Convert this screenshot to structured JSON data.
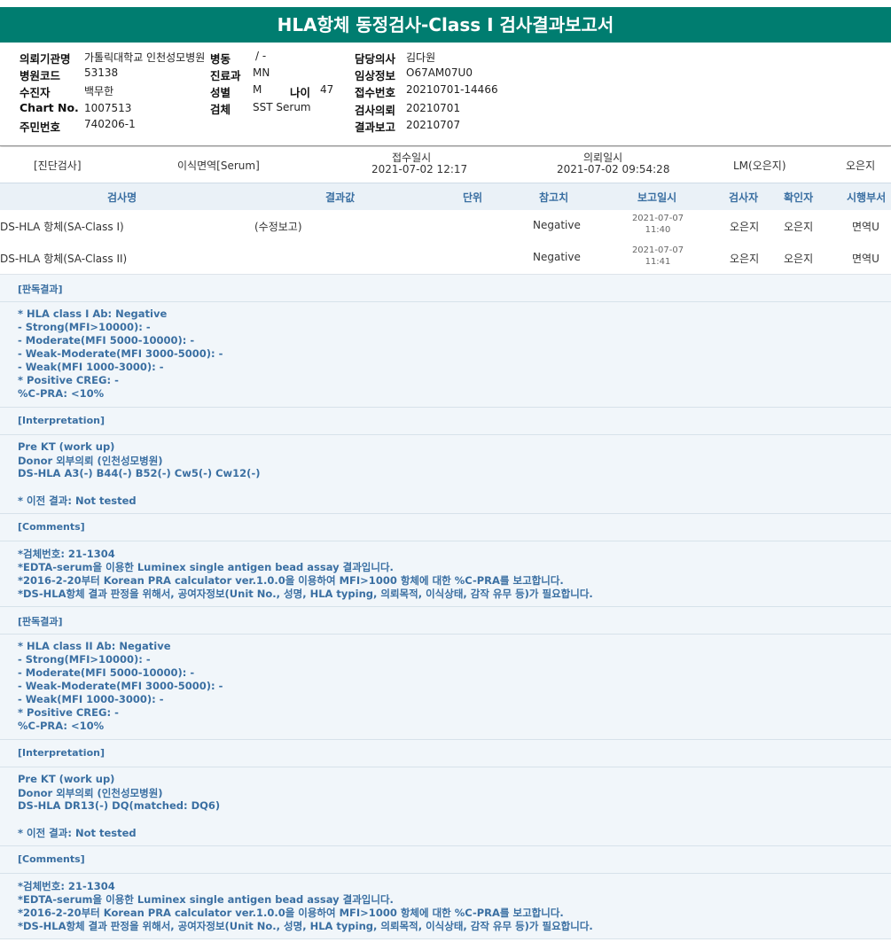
{
  "title": "HLA항체 동정검사-Class I 검사결과보고서",
  "patient": {
    "hospital_label": "의뢰기관명",
    "hospital": "가톨릭대학교 인천성모병원",
    "ward_label": "병동",
    "ward": "/ -",
    "doctor_label": "담당의사",
    "doctor": "김다원",
    "hospital_code_label": "병원코드",
    "hospital_code": "53138",
    "dept_label": "진료과",
    "dept": "MN",
    "clinical_label": "임상정보",
    "clinical": "O67AM07U0",
    "name_label": "수진자",
    "name": "백무한",
    "sex_label": "성별",
    "sex": "M",
    "age_label": "나이",
    "age": "47",
    "reception_no_label": "접수번호",
    "reception_no": "20210701-14466",
    "chart_label": "Chart No.",
    "chart": "1007513",
    "specimen_label": "검체",
    "specimen": "SST Serum",
    "request_date_label": "검사의뢰",
    "request_date": "20210701",
    "id_label": "주민번호",
    "id": "740206-1",
    "report_date_label": "결과보고",
    "report_date": "20210707"
  },
  "reception": {
    "diagnosis": "[진단검사]",
    "specimen_type": "이식면역[Serum]",
    "received_label": "접수일시",
    "received": "2021-07-02  12:17",
    "requested_label": "의뢰일시",
    "requested": "2021-07-02  09:54:28",
    "staff1": "LM(오은지)",
    "staff2": "오은지"
  },
  "table": {
    "headers": [
      "검사명",
      "결과값",
      "단위",
      "참고치",
      "보고일시",
      "검사자",
      "확인자",
      "시행부서"
    ],
    "rows": [
      {
        "name": "DS-HLA 항체(SA-Class I)",
        "result": "(수정보고)",
        "unit": "",
        "ref": "Negative",
        "date": "2021-07-07",
        "time": "11:40",
        "tester": "오은지",
        "checker": "오은지",
        "dept": "면역U"
      },
      {
        "name": "DS-HLA 항체(SA-Class II)",
        "result": "",
        "unit": "",
        "ref": "Negative",
        "date": "2021-07-07",
        "time": "11:41",
        "tester": "오은지",
        "checker": "오은지",
        "dept": "면역U"
      }
    ]
  },
  "sections": {
    "s1": {
      "title": "[판독결과]",
      "lines": [
        "* HLA class I Ab: Negative",
        "- Strong(MFI>10000): -",
        "- Moderate(MFI 5000-10000): -",
        "- Weak-Moderate(MFI 3000-5000): -",
        "- Weak(MFI 1000-3000): -",
        "* Positive CREG: -",
        " %C-PRA: <10%"
      ]
    },
    "s2": {
      "title": "[Interpretation]",
      "lines": [
        "Pre KT (work up)",
        "Donor 외부의뢰 (인천성모병원)",
        "DS-HLA A3(-) B44(-) B52(-) Cw5(-) Cw12(-)",
        "",
        "* 이전 결과: Not tested"
      ]
    },
    "s3": {
      "title": "[Comments]",
      "lines": [
        "*검체번호: 21-1304",
        "*EDTA-serum을 이용한 Luminex single antigen bead assay 결과입니다.",
        "*2016-2-20부터 Korean PRA calculator ver.1.0.0을 이용하여 MFI>1000 항체에 대한 %C-PRA를 보고합니다.",
        "*DS-HLA항체 결과 판정을 위해서, 공여자정보(Unit No., 성명, HLA typing, 의뢰목적, 이식상태, 감작 유무 등)가 필요합니다."
      ]
    },
    "s4": {
      "title": "[판독결과]",
      "lines": [
        "* HLA class II Ab: Negative",
        "- Strong(MFI>10000): -",
        "- Moderate(MFI 5000-10000): -",
        "- Weak-Moderate(MFI 3000-5000): -",
        "- Weak(MFI 1000-3000): -",
        "* Positive CREG: -",
        " %C-PRA: <10%"
      ]
    },
    "s5": {
      "title": "[Interpretation]",
      "lines": [
        "Pre KT (work up)",
        "Donor 외부의뢰 (인천성모병원)",
        "DS-HLA DR13(-) DQ(matched: DQ6)",
        "",
        "* 이전 결과: Not tested"
      ]
    },
    "s6": {
      "title": "[Comments]",
      "lines": [
        "*검체번호: 21-1304",
        "*EDTA-serum을 이용한 Luminex single antigen bead assay 결과입니다.",
        "*2016-2-20부터 Korean PRA calculator ver.1.0.0을 이용하여 MFI>1000 항체에 대한 %C-PRA를 보고합니다.",
        "*DS-HLA항체 결과 판정을 위해서, 공여자정보(Unit No., 성명, HLA typing, 의뢰목적, 이식상태, 감작 유무 등)가 필요합니다."
      ]
    }
  }
}
